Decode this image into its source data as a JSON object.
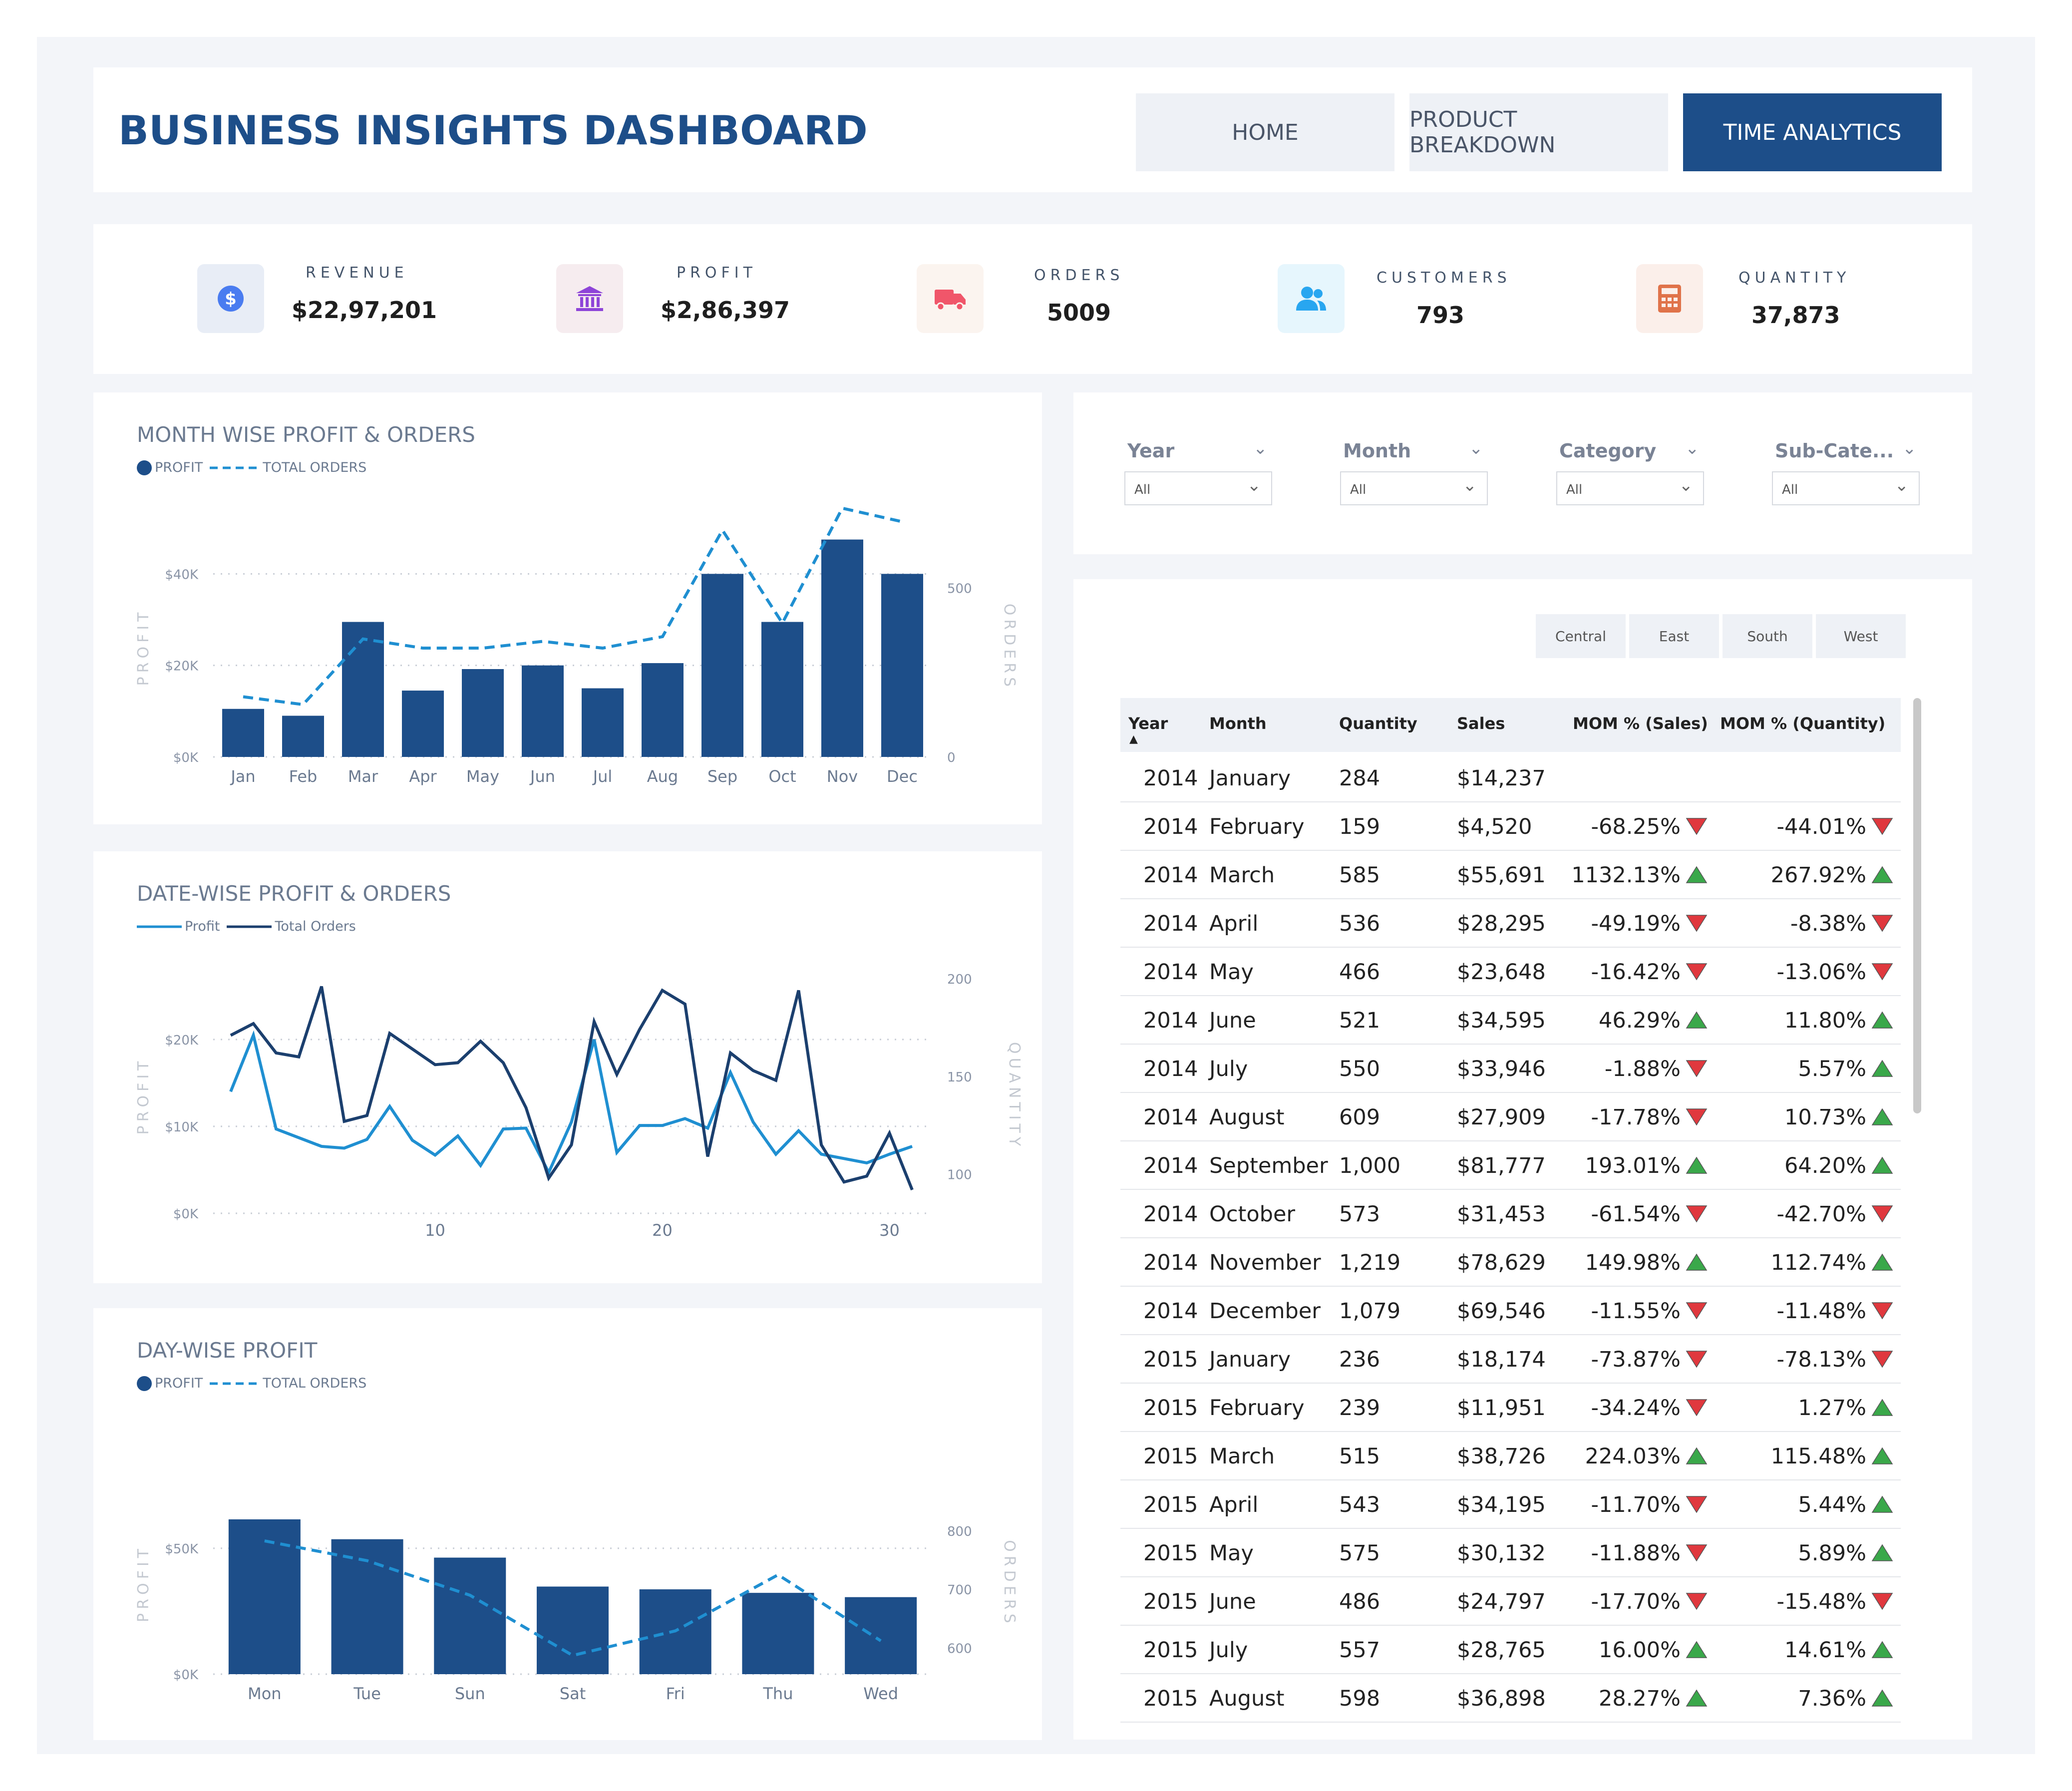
{
  "header": {
    "title": "BUSINESS INSIGHTS DASHBOARD",
    "nav": [
      {
        "label": "HOME",
        "active": false
      },
      {
        "label": "PRODUCT BREAKDOWN",
        "active": false
      },
      {
        "label": "TIME ANALYTICS",
        "active": true
      }
    ]
  },
  "kpis": [
    {
      "label": "REVENUE",
      "value": "$22,97,201",
      "icon": "dollar-icon",
      "icon_color": "#4a7cf0",
      "icon_bg": "#e8edf6"
    },
    {
      "label": "PROFIT",
      "value": "$2,86,397",
      "icon": "bank-icon",
      "icon_color": "#8e44d8",
      "icon_bg": "#f6ecef"
    },
    {
      "label": "ORDERS",
      "value": "5009",
      "icon": "truck-icon",
      "icon_color": "#f0566a",
      "icon_bg": "#fbf4ef"
    },
    {
      "label": "CUSTOMERS",
      "value": "793",
      "icon": "users-icon",
      "icon_color": "#28a6f0",
      "icon_bg": "#e6f6fd"
    },
    {
      "label": "QUANTITY",
      "value": "37,873",
      "icon": "calculator-icon",
      "icon_color": "#e0734a",
      "icon_bg": "#fbefea"
    }
  ],
  "colors": {
    "bar": "#1d4e89",
    "line_light": "#1f8fd1",
    "line_dark": "#1b3f6e",
    "up": "#3aa84a",
    "down": "#e0383e"
  },
  "chart_data": [
    {
      "type": "bar",
      "title": "MONTH WISE PROFIT & ORDERS",
      "legend": [
        "PROFIT",
        "TOTAL ORDERS"
      ],
      "ylabel": "PROFIT",
      "y2label": "ORDERS",
      "ytick_labels": [
        "$0K",
        "$20K",
        "$40K"
      ],
      "y2tick_labels": [
        "0",
        "500"
      ],
      "ylim": [
        0,
        48000
      ],
      "y2lim": [
        0,
        650
      ],
      "categories": [
        "Jan",
        "Feb",
        "Mar",
        "Apr",
        "May",
        "Jun",
        "Jul",
        "Aug",
        "Sep",
        "Oct",
        "Nov",
        "Dec"
      ],
      "series": [
        {
          "name": "PROFIT",
          "type": "bar",
          "values": [
            10500,
            9000,
            29500,
            14500,
            19200,
            20000,
            15000,
            20500,
            40000,
            29500,
            47500,
            40000
          ]
        },
        {
          "name": "TOTAL ORDERS",
          "type": "line",
          "dashed": true,
          "axis": "y2",
          "values": [
            178,
            155,
            349,
            322,
            322,
            342,
            322,
            356,
            671,
            396,
            736,
            696
          ]
        }
      ]
    },
    {
      "type": "line",
      "title": "DATE-WISE PROFIT & ORDERS",
      "legend": [
        "Profit",
        "Total Orders"
      ],
      "ylabel": "PROFIT",
      "y2label": "QUANTITY",
      "ytick_labels": [
        "$0K",
        "$10K",
        "$20K"
      ],
      "y2tick_labels": [
        "100",
        "150",
        "200"
      ],
      "xtick_labels": [
        "10",
        "20",
        "30"
      ],
      "ylim": [
        0,
        27000
      ],
      "y2lim": [
        80,
        200
      ],
      "x": [
        1,
        2,
        3,
        4,
        5,
        6,
        7,
        8,
        9,
        10,
        11,
        12,
        13,
        14,
        15,
        16,
        17,
        18,
        19,
        20,
        21,
        22,
        23,
        24,
        25,
        26,
        27,
        28,
        29,
        30,
        31
      ],
      "series": [
        {
          "name": "Profit",
          "values": [
            14000,
            20500,
            9700,
            8700,
            7700,
            7500,
            8500,
            12300,
            8400,
            6700,
            8900,
            5500,
            9700,
            9800,
            4700,
            10500,
            20000,
            7000,
            10100,
            10100,
            10900,
            9800,
            16200,
            10500,
            6800,
            9500,
            6800,
            6300,
            5800,
            6800,
            7700
          ]
        },
        {
          "name": "Total Orders",
          "axis": "y2",
          "values": [
            171,
            177,
            162,
            160,
            196,
            127,
            130,
            172,
            164,
            156,
            157,
            168,
            157,
            134,
            98,
            115,
            178,
            151,
            174,
            194,
            187,
            109,
            162,
            153,
            148,
            194,
            115,
            96,
            99,
            121,
            92
          ]
        }
      ]
    },
    {
      "type": "bar",
      "title": "DAY-WISE PROFIT",
      "legend": [
        "PROFIT",
        "TOTAL ORDERS"
      ],
      "ylabel": "PROFIT",
      "y2label": "ORDERS",
      "ytick_labels": [
        "$0K",
        "$50K"
      ],
      "y2tick_labels": [
        "600",
        "700",
        "800"
      ],
      "ylim": [
        0,
        72000
      ],
      "y2lim": [
        555,
        865
      ],
      "categories": [
        "Mon",
        "Tue",
        "Sun",
        "Sat",
        "Fri",
        "Thu",
        "Wed"
      ],
      "series": [
        {
          "name": "PROFIT",
          "type": "bar",
          "values": [
            61500,
            53600,
            46300,
            34800,
            33700,
            32300,
            30600
          ]
        },
        {
          "name": "TOTAL ORDERS",
          "type": "line",
          "dashed": true,
          "axis": "y2",
          "values": [
            783,
            749,
            690,
            587,
            629,
            725,
            612
          ]
        }
      ]
    }
  ],
  "filters": [
    {
      "label": "Year",
      "value": "All"
    },
    {
      "label": "Month",
      "value": "All"
    },
    {
      "label": "Category",
      "value": "All"
    },
    {
      "label": "Sub-Cate...",
      "value": "All"
    }
  ],
  "regions": [
    "Central",
    "East",
    "South",
    "West"
  ],
  "table": {
    "columns": [
      "Year",
      "Month",
      "Quantity",
      "Sales",
      "MOM % (Sales)",
      "MOM % (Quantity)"
    ],
    "rows": [
      {
        "year": "2014",
        "month": "January",
        "qty": "284",
        "sales": "$14,237",
        "mom_s": "",
        "mom_s_dir": "",
        "mom_q": "",
        "mom_q_dir": ""
      },
      {
        "year": "2014",
        "month": "February",
        "qty": "159",
        "sales": "$4,520",
        "mom_s": "-68.25%",
        "mom_s_dir": "down",
        "mom_q": "-44.01%",
        "mom_q_dir": "down"
      },
      {
        "year": "2014",
        "month": "March",
        "qty": "585",
        "sales": "$55,691",
        "mom_s": "1132.13%",
        "mom_s_dir": "up",
        "mom_q": "267.92%",
        "mom_q_dir": "up"
      },
      {
        "year": "2014",
        "month": "April",
        "qty": "536",
        "sales": "$28,295",
        "mom_s": "-49.19%",
        "mom_s_dir": "down",
        "mom_q": "-8.38%",
        "mom_q_dir": "down"
      },
      {
        "year": "2014",
        "month": "May",
        "qty": "466",
        "sales": "$23,648",
        "mom_s": "-16.42%",
        "mom_s_dir": "down",
        "mom_q": "-13.06%",
        "mom_q_dir": "down"
      },
      {
        "year": "2014",
        "month": "June",
        "qty": "521",
        "sales": "$34,595",
        "mom_s": "46.29%",
        "mom_s_dir": "up",
        "mom_q": "11.80%",
        "mom_q_dir": "up"
      },
      {
        "year": "2014",
        "month": "July",
        "qty": "550",
        "sales": "$33,946",
        "mom_s": "-1.88%",
        "mom_s_dir": "down",
        "mom_q": "5.57%",
        "mom_q_dir": "up"
      },
      {
        "year": "2014",
        "month": "August",
        "qty": "609",
        "sales": "$27,909",
        "mom_s": "-17.78%",
        "mom_s_dir": "down",
        "mom_q": "10.73%",
        "mom_q_dir": "up"
      },
      {
        "year": "2014",
        "month": "September",
        "qty": "1,000",
        "sales": "$81,777",
        "mom_s": "193.01%",
        "mom_s_dir": "up",
        "mom_q": "64.20%",
        "mom_q_dir": "up"
      },
      {
        "year": "2014",
        "month": "October",
        "qty": "573",
        "sales": "$31,453",
        "mom_s": "-61.54%",
        "mom_s_dir": "down",
        "mom_q": "-42.70%",
        "mom_q_dir": "down"
      },
      {
        "year": "2014",
        "month": "November",
        "qty": "1,219",
        "sales": "$78,629",
        "mom_s": "149.98%",
        "mom_s_dir": "up",
        "mom_q": "112.74%",
        "mom_q_dir": "up"
      },
      {
        "year": "2014",
        "month": "December",
        "qty": "1,079",
        "sales": "$69,546",
        "mom_s": "-11.55%",
        "mom_s_dir": "down",
        "mom_q": "-11.48%",
        "mom_q_dir": "down"
      },
      {
        "year": "2015",
        "month": "January",
        "qty": "236",
        "sales": "$18,174",
        "mom_s": "-73.87%",
        "mom_s_dir": "down",
        "mom_q": "-78.13%",
        "mom_q_dir": "down"
      },
      {
        "year": "2015",
        "month": "February",
        "qty": "239",
        "sales": "$11,951",
        "mom_s": "-34.24%",
        "mom_s_dir": "down",
        "mom_q": "1.27%",
        "mom_q_dir": "up"
      },
      {
        "year": "2015",
        "month": "March",
        "qty": "515",
        "sales": "$38,726",
        "mom_s": "224.03%",
        "mom_s_dir": "up",
        "mom_q": "115.48%",
        "mom_q_dir": "up"
      },
      {
        "year": "2015",
        "month": "April",
        "qty": "543",
        "sales": "$34,195",
        "mom_s": "-11.70%",
        "mom_s_dir": "down",
        "mom_q": "5.44%",
        "mom_q_dir": "up"
      },
      {
        "year": "2015",
        "month": "May",
        "qty": "575",
        "sales": "$30,132",
        "mom_s": "-11.88%",
        "mom_s_dir": "down",
        "mom_q": "5.89%",
        "mom_q_dir": "up"
      },
      {
        "year": "2015",
        "month": "June",
        "qty": "486",
        "sales": "$24,797",
        "mom_s": "-17.70%",
        "mom_s_dir": "down",
        "mom_q": "-15.48%",
        "mom_q_dir": "down"
      },
      {
        "year": "2015",
        "month": "July",
        "qty": "557",
        "sales": "$28,765",
        "mom_s": "16.00%",
        "mom_s_dir": "up",
        "mom_q": "14.61%",
        "mom_q_dir": "up"
      },
      {
        "year": "2015",
        "month": "August",
        "qty": "598",
        "sales": "$36,898",
        "mom_s": "28.27%",
        "mom_s_dir": "up",
        "mom_q": "7.36%",
        "mom_q_dir": "up"
      }
    ]
  }
}
